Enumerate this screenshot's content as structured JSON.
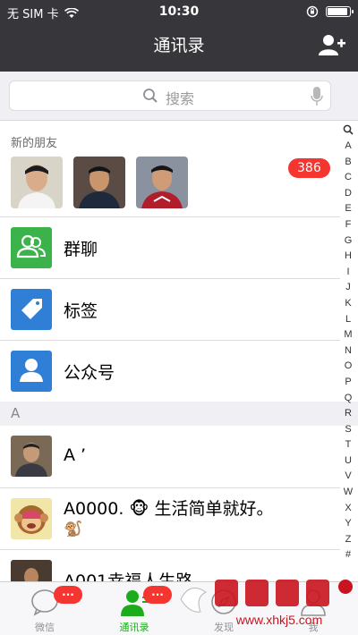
{
  "status": {
    "carrier": "无 SIM 卡",
    "time": "10:30"
  },
  "nav": {
    "title": "通讯录"
  },
  "search": {
    "placeholder": "搜索"
  },
  "new_friends": {
    "title": "新的朋友",
    "badge": "386"
  },
  "rows": [
    {
      "label": "群聊",
      "color": "#3cb34a"
    },
    {
      "label": "标签",
      "color": "#2f7fd6"
    },
    {
      "label": "公众号",
      "color": "#2f7fd6"
    }
  ],
  "section_header": "A",
  "contacts": [
    {
      "name": "A ’"
    },
    {
      "name": "A0000. 🐵 生活简单就好。",
      "extra": "🐒"
    },
    {
      "name": "A001幸福人生路"
    }
  ],
  "index_letters": [
    "A",
    "B",
    "C",
    "D",
    "E",
    "F",
    "G",
    "H",
    "I",
    "J",
    "K",
    "L",
    "M",
    "N",
    "O",
    "P",
    "Q",
    "R",
    "S",
    "T",
    "U",
    "V",
    "W",
    "X",
    "Y",
    "Z",
    "#"
  ],
  "tabs": [
    {
      "label": "微信",
      "badge": "...",
      "active": false
    },
    {
      "label": "通讯录",
      "badge": "...",
      "active": true
    },
    {
      "label": "发现",
      "badge": "",
      "active": false
    },
    {
      "label": "我",
      "badge": "",
      "active": false
    }
  ],
  "watermark": {
    "text": "www.xhkj5.com"
  },
  "colors": {
    "navbar": "#37373b",
    "accent": "#1aad19",
    "badge": "#f43530"
  }
}
